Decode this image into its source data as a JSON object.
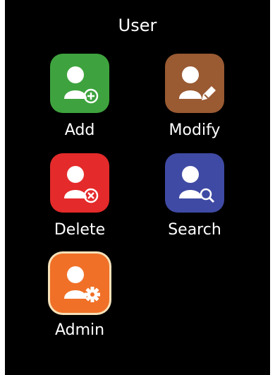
{
  "screen": {
    "title": "User"
  },
  "menu": [
    {
      "label": "Add",
      "color": "#3ea33e",
      "icon": "user-add-icon",
      "selected": false
    },
    {
      "label": "Modify",
      "color": "#9a5a32",
      "icon": "user-edit-icon",
      "selected": false
    },
    {
      "label": "Delete",
      "color": "#e42a2a",
      "icon": "user-delete-icon",
      "selected": false
    },
    {
      "label": "Search",
      "color": "#3f4aa4",
      "icon": "user-search-icon",
      "selected": false
    },
    {
      "label": "Admin",
      "color": "#f07027",
      "icon": "user-admin-icon",
      "selected": true
    }
  ],
  "colors": {
    "background": "#000000",
    "text": "#ffffff",
    "selection_border": "#f5e1b8"
  }
}
